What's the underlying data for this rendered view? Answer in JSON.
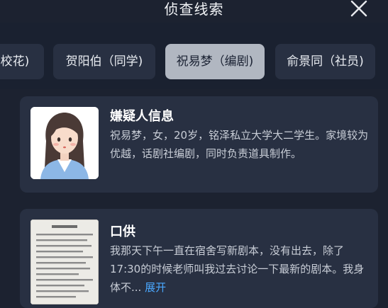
{
  "header": {
    "title": "侦查线索",
    "close_icon": "close-icon"
  },
  "tabs": [
    {
      "label": "校花)",
      "active": false
    },
    {
      "label": "贺阳伯（同学)",
      "active": false
    },
    {
      "label": "祝易梦（编剧)",
      "active": true
    },
    {
      "label": "俞景同（社员)",
      "active": false
    }
  ],
  "suspect": {
    "title": "嫌疑人信息",
    "description": "祝易梦，女，20岁，铭泽私立大学大二学生。家境较为优越，话剧社编剧，同时负责道具制作。",
    "avatar_icon": "woman-avatar-icon"
  },
  "confession": {
    "title": "口供",
    "text": "我那天下午一直在宿舍写新剧本，没有出去，除了17:30的时候老师叫我过去讨论一下最新的剧本。我身体不...",
    "expand_label": "展开",
    "document_icon": "document-thumbnail-icon"
  },
  "colors": {
    "background": "#1c2230",
    "card": "#283042",
    "active_tab": "#b1b7c1",
    "link": "#4aa8ff"
  }
}
